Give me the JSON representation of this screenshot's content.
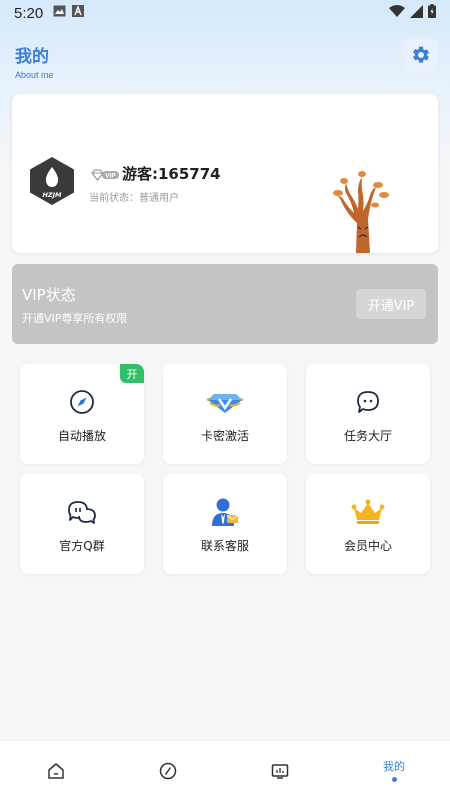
{
  "status_bar": {
    "time": "5:20"
  },
  "header": {
    "title": "我的",
    "subtitle": "About me"
  },
  "profile": {
    "avatar_text": "HZJM",
    "vip_badge": "VIP",
    "username": "游客:165774",
    "status": "当前状态：普通用户"
  },
  "vip": {
    "title": "VIP状态",
    "description": "开通VIP尊享所有权限",
    "button": "开通VIP"
  },
  "grid": [
    {
      "label": "自动播放",
      "icon": "compass-icon",
      "badge": "开"
    },
    {
      "label": "卡密激活",
      "icon": "vip-diamond-icon"
    },
    {
      "label": "任务大厅",
      "icon": "chat-bubble-icon"
    },
    {
      "label": "官方Q群",
      "icon": "group-chat-icon"
    },
    {
      "label": "联系客服",
      "icon": "customer-service-icon"
    },
    {
      "label": "会员中心",
      "icon": "crown-icon"
    }
  ],
  "bottom_nav": {
    "items": [
      {
        "icon": "home-icon"
      },
      {
        "icon": "discover-icon"
      },
      {
        "icon": "tv-icon"
      },
      {
        "label": "我的",
        "active": true
      }
    ]
  },
  "colors": {
    "accent": "#3b7fd8",
    "badge_green": "#32bf6a",
    "vip_banner": "#c4c4c4"
  }
}
